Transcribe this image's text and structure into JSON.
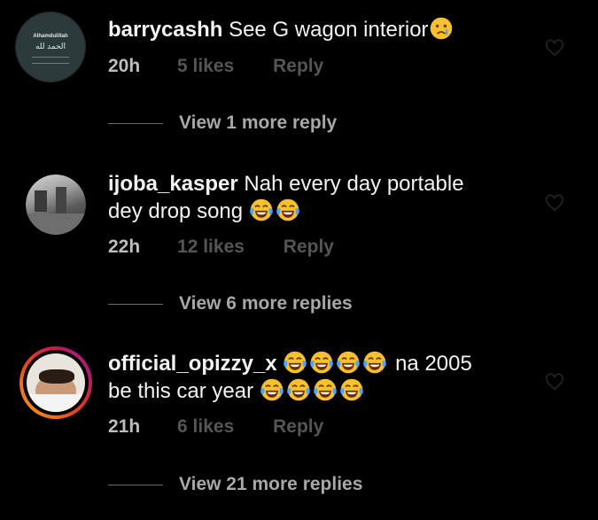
{
  "comments": [
    {
      "username": "barrycashh",
      "text": "See G wagon interior",
      "emoji_count": 1,
      "emoji": "crying-face",
      "time": "20h",
      "likes": "5 likes",
      "reply": "Reply",
      "view_more": "View 1 more reply",
      "avatar_text_top": "Alhamdulillah",
      "avatar_text_arabic": "الحمد لله"
    },
    {
      "username": "ijoba_kasper",
      "text_line1": "Nah every day portable",
      "text_line2": "dey drop song",
      "emoji_count": 2,
      "emoji": "tears-of-joy",
      "time": "22h",
      "likes": "12 likes",
      "reply": "Reply",
      "view_more": "View 6 more replies"
    },
    {
      "username": "official_opizzy_x",
      "text_line1_suffix": "na 2005",
      "text_line2": "be this car year",
      "emoji_count_line1": 4,
      "emoji_count_line2": 4,
      "emoji": "tears-of-joy",
      "time": "21h",
      "likes": "6 likes",
      "reply": "Reply",
      "view_more": "View 21 more replies"
    }
  ],
  "colors": {
    "background": "#000000",
    "primary_text": "#f2f2f2",
    "secondary_text": "#8e8e8e",
    "story_ring_start": "#f9a825",
    "story_ring_end": "#c2185b"
  }
}
